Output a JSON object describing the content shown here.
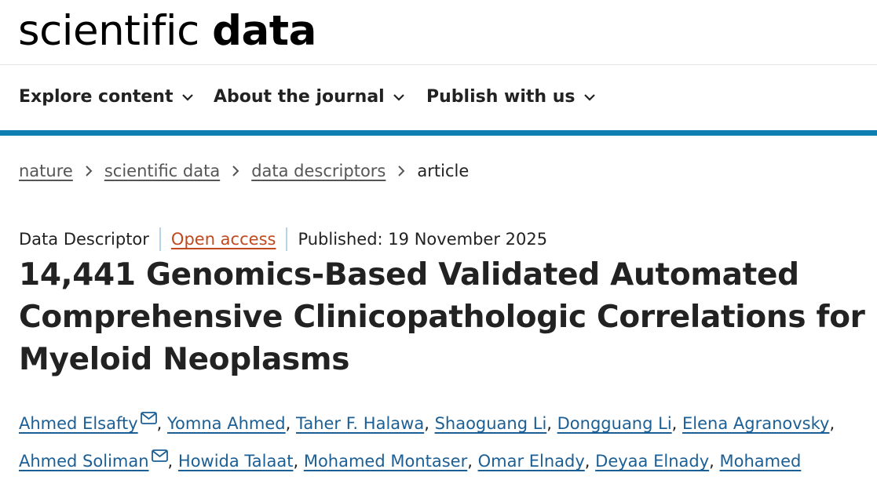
{
  "header": {
    "logo_light": "scientific",
    "logo_bold": "data"
  },
  "nav": {
    "items": [
      {
        "label": "Explore content"
      },
      {
        "label": "About the journal"
      },
      {
        "label": "Publish with us"
      }
    ]
  },
  "colors": {
    "accent_bar": "#0f7eb0",
    "author_link": "#1c5f95",
    "open_access": "#c1491d"
  },
  "breadcrumb": {
    "items": [
      "nature",
      "scientific data",
      "data descriptors"
    ],
    "current": "article"
  },
  "article": {
    "type": "Data Descriptor",
    "access": "Open access",
    "published": "Published: 19 November 2025",
    "title": "14,441 Genomics-Based Validated Automated Comprehensive Clinicopathologic Correlations for Myeloid Neoplasms",
    "authors": [
      {
        "name": "Ahmed Elsafty",
        "corresponding": true
      },
      {
        "name": "Yomna Ahmed",
        "corresponding": false
      },
      {
        "name": "Taher F. Halawa",
        "corresponding": false
      },
      {
        "name": "Shaoguang Li",
        "corresponding": false
      },
      {
        "name": "Dongguang Li",
        "corresponding": false
      },
      {
        "name": "Elena Agranovsky",
        "corresponding": false
      },
      {
        "name": "Ahmed Soliman",
        "corresponding": true
      },
      {
        "name": "Howida Talaat",
        "corresponding": false
      },
      {
        "name": "Mohamed Montaser",
        "corresponding": false
      },
      {
        "name": "Omar Elnady",
        "corresponding": false
      },
      {
        "name": "Deyaa Elnady",
        "corresponding": false
      },
      {
        "name": "Mohamed",
        "corresponding": false
      }
    ]
  }
}
